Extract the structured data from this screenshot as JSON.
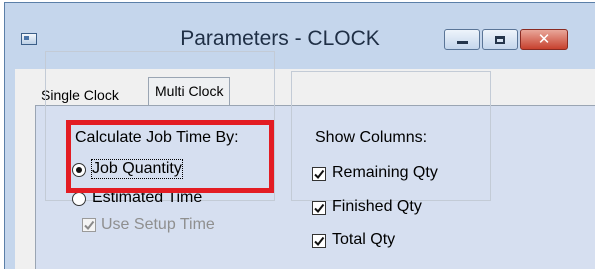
{
  "window": {
    "title": "Parameters - CLOCK",
    "app_icon": "app-window-icon",
    "controls": {
      "minimize_icon": "minimize-icon",
      "maximize_icon": "maximize-icon",
      "close_icon": "close-icon"
    }
  },
  "tabs": [
    {
      "label": "Single Clock",
      "selected": false
    },
    {
      "label": "Multi Clock",
      "selected": true
    }
  ],
  "calculate": {
    "heading": "Calculate Job Time By:",
    "options": [
      {
        "label": "Job Quantity",
        "selected": true
      },
      {
        "label": "Estimated Time",
        "selected": false
      }
    ],
    "use_setup_time": {
      "label": "Use Setup Time",
      "checked": true,
      "enabled": false
    }
  },
  "show_columns": {
    "heading": "Show Columns:",
    "items": [
      {
        "label": "Remaining Qty",
        "checked": true
      },
      {
        "label": "Finished Qty",
        "checked": true
      },
      {
        "label": "Total Qty",
        "checked": true
      }
    ]
  },
  "annotation": {
    "color": "#e31c23"
  }
}
